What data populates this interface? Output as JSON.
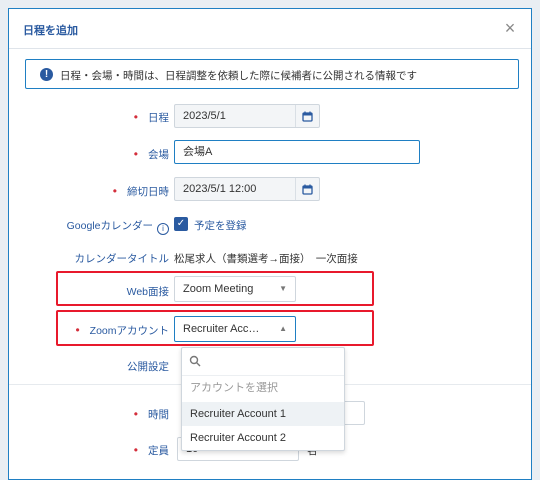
{
  "dialog": {
    "title": "日程を追加",
    "close_symbol": "×"
  },
  "info": {
    "icon": "!",
    "text": "日程・会場・時間は、日程調整を依頼した際に候補者に公開される情報です"
  },
  "fields": {
    "schedule": {
      "label": "日程",
      "value": "2023/5/1"
    },
    "venue": {
      "label": "会場",
      "value": "会場A"
    },
    "deadline": {
      "label": "締切日時",
      "value": "2023/5/1 12:00"
    },
    "google_calendar": {
      "label": "Googleカレンダー",
      "checkbox_label": "予定を登録",
      "checked": true
    },
    "calendar_title": {
      "label": "カレンダータイトル",
      "value": "松尾求人（書類選考→面接）　一次面接"
    },
    "web_interview": {
      "label": "Web面接",
      "value": "Zoom Meeting"
    },
    "zoom_account": {
      "label": "Zoomアカウント",
      "value": "Recruiter Acc…"
    },
    "public_settings": {
      "label": "公開設定"
    },
    "time": {
      "label": "時間"
    },
    "capacity": {
      "label": "定員",
      "value": "10",
      "unit": "名"
    }
  },
  "required_mark": "•",
  "dropdown": {
    "search_placeholder": "",
    "options": [
      "アカウントを選択",
      "Recruiter Account 1",
      "Recruiter Account 2"
    ]
  },
  "colors": {
    "accent": "#2a5aa0",
    "required": "#d42f3c",
    "highlight_border": "#e8192c"
  }
}
